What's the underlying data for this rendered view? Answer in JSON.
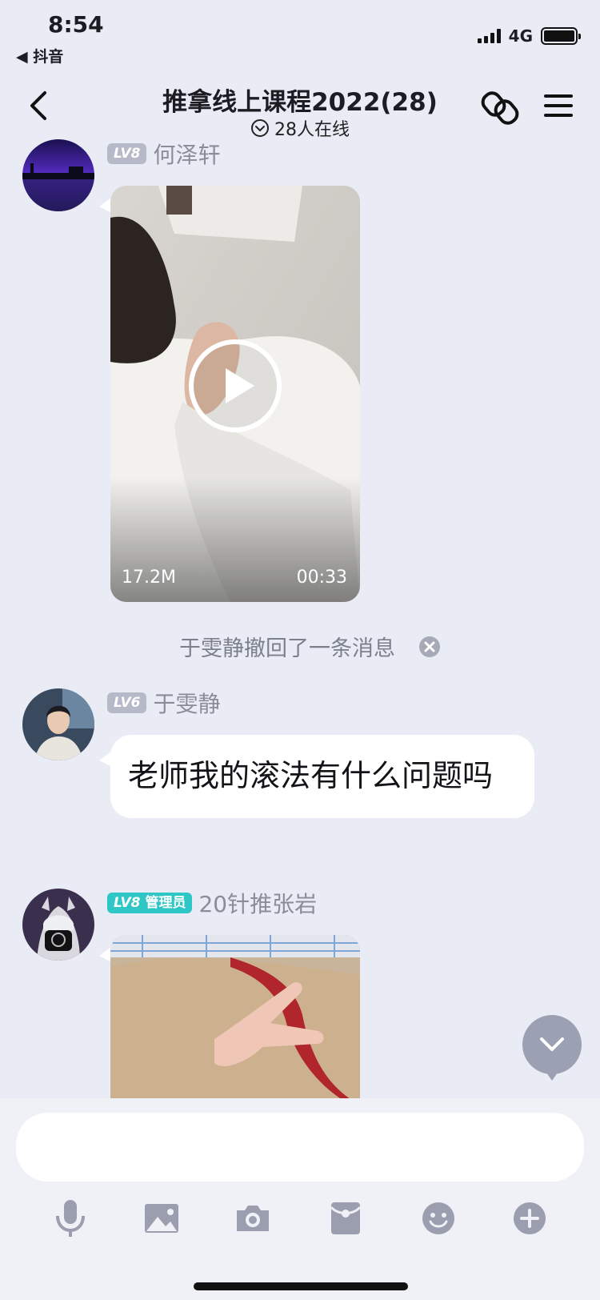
{
  "status": {
    "time": "8:54",
    "back_app": "◀ 抖音",
    "network": "4G"
  },
  "header": {
    "title": "推拿线上课程2022(28)",
    "online_text": "28人在线",
    "icons": [
      "back-chevron-icon",
      "link-icon",
      "menu-icon"
    ]
  },
  "messages": [
    {
      "level": "LV8",
      "sender": "何泽轩",
      "type": "video",
      "video": {
        "size": "17.2M",
        "duration": "00:33"
      }
    },
    {
      "type": "recall_notice",
      "text": "于雯静撤回了一条消息"
    },
    {
      "level": "LV6",
      "sender": "于雯静",
      "type": "text",
      "text": "老师我的滚法有什么问题吗"
    },
    {
      "level": "LV8",
      "role": "管理员",
      "sender": "20针推张岩",
      "type": "video"
    }
  ],
  "composer": {
    "input_value": "",
    "tools": [
      "microphone-icon",
      "image-icon",
      "camera-icon",
      "red-packet-icon",
      "emoji-icon",
      "plus-icon"
    ]
  },
  "colors": {
    "background": "#e9ebf5",
    "admin_badge": "#2fc6c6",
    "level_badge": "#b6b9c7"
  }
}
